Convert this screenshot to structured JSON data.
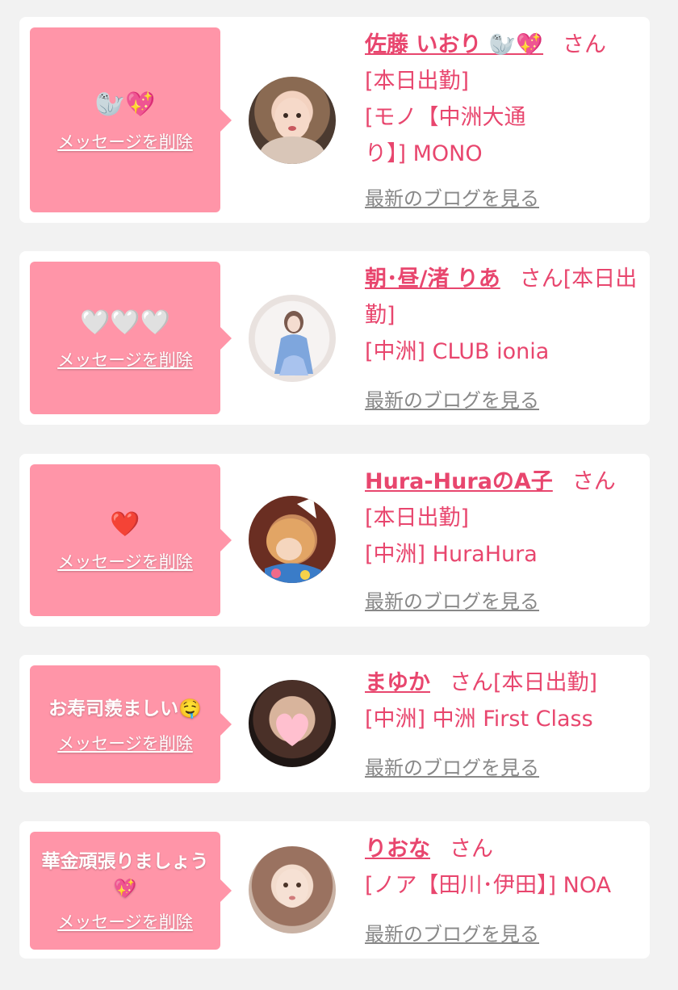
{
  "delete_label": "メッセージを削除",
  "blog_label": "最新のブログを見る",
  "colors": {
    "accent": "#e8466e",
    "bubble": "#ff95a8",
    "background": "#f2f2f2",
    "link_gray": "#888888"
  },
  "entries": [
    {
      "message": "🦭💖",
      "name": "佐藤 いおり 🦭💖",
      "honorific": "さん",
      "status": "[本日出勤]",
      "shop": "[モノ【中洲大通り】] MONO"
    },
    {
      "message": "🤍🤍🤍",
      "name": "朝･昼/渚 りあ",
      "honorific": "さん",
      "status": "[本日出勤]",
      "shop": "[中洲] CLUB ionia"
    },
    {
      "message": "❤️",
      "name": "Hura-HuraのA子",
      "honorific": "さん",
      "status": "[本日出勤]",
      "shop": "[中洲] HuraHura"
    },
    {
      "message": "お寿司羨ましい🤤",
      "name": "まゆか",
      "honorific": "さん",
      "status": "[本日出勤]",
      "shop": "[中洲] 中洲 First Class"
    },
    {
      "message": "華金頑張りましょう💖",
      "name": "りおな",
      "honorific": "さん",
      "status": "",
      "shop": "[ノア【田川･伊田】] NOA"
    }
  ]
}
